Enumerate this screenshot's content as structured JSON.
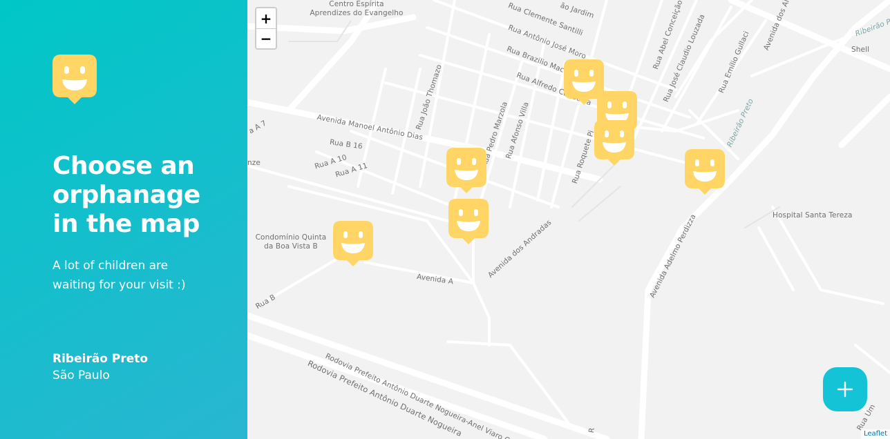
{
  "sidebar": {
    "title": "Choose an orphanage in the map",
    "subtitle": "A lot of children are waiting for your visit :)",
    "city": "Ribeirão Preto",
    "state": "São Paulo",
    "logo_icon": "happy-marker-icon",
    "gradient": [
      "#29B6D1",
      "#00C7C7"
    ]
  },
  "map": {
    "zoom_in_label": "+",
    "zoom_out_label": "−",
    "attribution": "Leaflet",
    "marker_color": "#FFD666",
    "fab_color": "#15C3D6",
    "fab_icon": "plus-icon",
    "labels": {
      "centro": "Centro Espírita Aprendizes do Evangelho",
      "rua_clemente": "Rua Clemente Santilli",
      "rua_antonio_jose": "Rua Antônio José Moro",
      "rua_brazilio": "Rua Brazilio Mac",
      "rua_alfredo": "Rua Alfredo Condeixa",
      "jardim": "ão Jardim",
      "rua_abel": "Rua Abel Conceição",
      "rua_jose_claudio": "Rua José Claudio Louzada",
      "rua_emilio": "Rua Emílio Gullaci",
      "avenida_dos_al": "Avenida dos Al",
      "ribeirao_preto_1": "Ribeirão Pr",
      "ribeirao_preto_2": "Ribeirão Preto",
      "shell": "Shell",
      "rua_joao_thomazo": "Rua João Thomazo",
      "rua_pedro_marzola": "Rua Pedro Marzola",
      "rua_afonso_villa": "Rua Afonso Villa",
      "rua_roquete": "Rua Roquete Pi",
      "av_manoel": "Avenida Manoel Antônio Dias",
      "rua_b16": "Rua B 16",
      "rua_a10": "Rua A 10",
      "rua_a11": "Rua A 11",
      "a7": "a A 7",
      "nze": "nze",
      "hospital": "Hospital Santa Tereza",
      "condominio": "Condomínio Quinta da Boa Vista B",
      "av_andradas": "Avenida dos Andradas",
      "av_a": "Avenida A",
      "av_adelmo": "Avenida Adelmo Perdizza",
      "rua_b": "Rua B",
      "rodovia_1": "Rodovia Prefeito Antônio Duarte Nogueira-Anel Viaro C",
      "rodovia_2": "Rodovia Prefeito Antônio Duarte Nogueira",
      "rua_um": "Rua Um",
      "r_bottom": "R"
    }
  }
}
